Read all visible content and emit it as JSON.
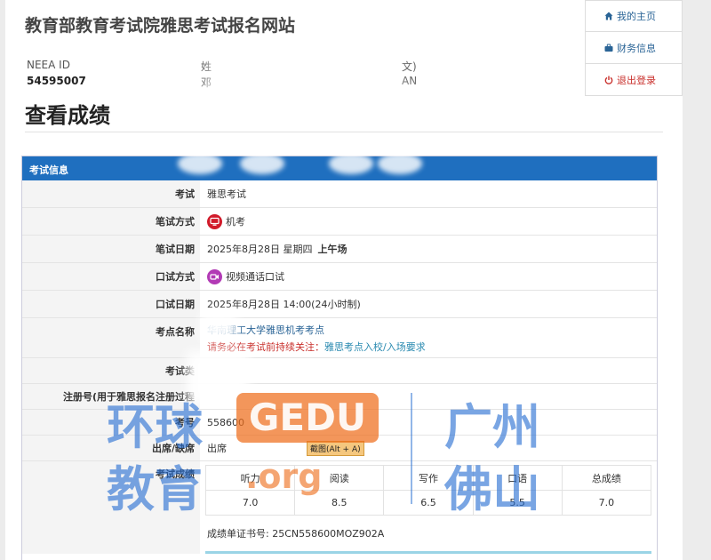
{
  "site": {
    "title": "教育部教育考试院雅思考试报名网站"
  },
  "profile": {
    "id_label": "NEEA ID",
    "id_value": "54595007",
    "name_label": "姓",
    "name_value": "邓",
    "name2_label": "文)",
    "name2_value": "AN"
  },
  "nav": {
    "items": [
      {
        "label": "我的主页",
        "icon": "home-icon"
      },
      {
        "label": "财务信息",
        "icon": "briefcase-icon"
      },
      {
        "label": "退出登录",
        "icon": "power-icon"
      }
    ]
  },
  "page": {
    "heading": "查看成绩"
  },
  "panel": {
    "title": "考试信息",
    "rows": {
      "exam": {
        "label": "考试",
        "value": "雅思考试"
      },
      "written_mode": {
        "label": "笔试方式",
        "value": "机考",
        "icon": "computer-icon"
      },
      "written_date": {
        "label": "笔试日期",
        "value": "2025年8月28日 星期四",
        "value_bold": "上午场"
      },
      "speaking_mode": {
        "label": "口试方式",
        "value": "视频通话口试",
        "icon": "video-icon"
      },
      "speaking_date": {
        "label": "口试日期",
        "value": "2025年8月28日 14:00(24小时制)"
      },
      "test_center": {
        "label": "考点名称",
        "value": "华南理工大学雅思机考考点",
        "notice_prefix": "请务必在考试前持续关注：",
        "notice_link": "雅思考点入校/入场要求"
      },
      "exam_type": {
        "label": "考试类",
        "value": ""
      },
      "registration": {
        "label": "注册号(用于雅思报名注册过程",
        "value": ""
      },
      "candidate_no": {
        "label": "考号",
        "value": "558600"
      },
      "attendance": {
        "label": "出席/缺席",
        "value": "出席",
        "shortcut_tip": "截图(Alt + A)"
      },
      "scores": {
        "label": "考试成绩"
      }
    },
    "scores": {
      "headers": [
        "听力",
        "阅读",
        "写作",
        "口语",
        "总成绩"
      ],
      "values": [
        "7.0",
        "8.5",
        "6.5",
        "5.5",
        "7.0"
      ]
    },
    "certificate": "成绩单证书号: 25CN558600MOZ902A"
  },
  "watermark": {
    "line1": "环球",
    "line2": "教育",
    "gedu": "GEDU",
    "org": ".org",
    "city1": "广州",
    "city2": "佛山"
  },
  "colors": {
    "panel_header": "#1f6fbf",
    "link": "#2a6496",
    "logout": "#c9302c",
    "watermark_blue": "#266ed2",
    "watermark_orange": "#ee6e1c"
  }
}
